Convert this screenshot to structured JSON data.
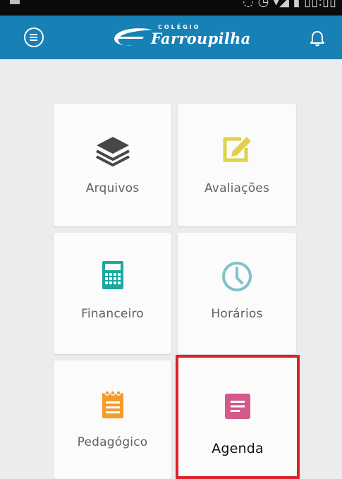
{
  "header": {
    "brand_small": "COLÉGIO",
    "brand_name": "Farroupilha",
    "color": "#1780b5"
  },
  "tiles": [
    {
      "label": "Arquivos",
      "icon": "layers-icon",
      "color": "#4a4a4a"
    },
    {
      "label": "Avaliações",
      "icon": "edit-icon",
      "color": "#dfd14a"
    },
    {
      "label": "Financeiro",
      "icon": "calculator-icon",
      "color": "#1aa8a0"
    },
    {
      "label": "Horários",
      "icon": "clock-icon",
      "color": "#7fc3c8"
    },
    {
      "label": "Pedagógico",
      "icon": "notepad-icon",
      "color": "#f59b2b"
    },
    {
      "label": "Agenda",
      "icon": "agenda-icon",
      "color": "#d45a8c",
      "highlighted": true
    }
  ],
  "highlight_color": "#e0202a"
}
